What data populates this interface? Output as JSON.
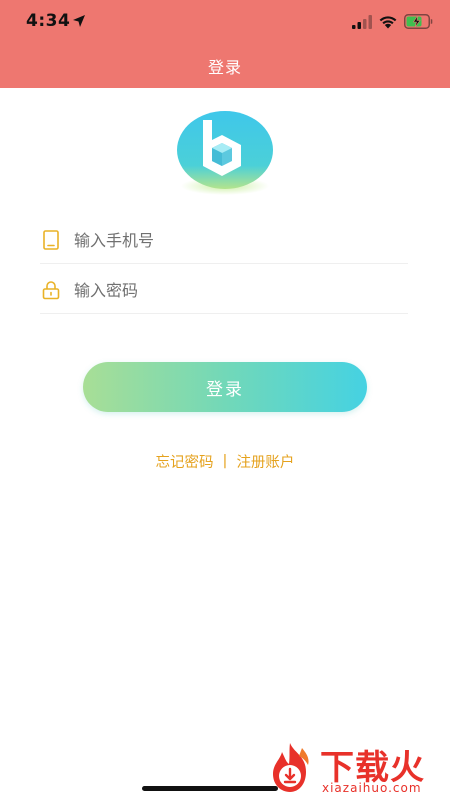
{
  "status_bar": {
    "time": "4:34"
  },
  "nav": {
    "title": "登录"
  },
  "form": {
    "phone_placeholder": "输入手机号",
    "password_placeholder": "输入密码",
    "login_label": "登录"
  },
  "links": {
    "forgot": "忘记密码",
    "separator": "|",
    "register": "注册账户"
  },
  "watermark": {
    "title": "下载火",
    "url": "xiazaihuo.com"
  },
  "colors": {
    "header": "#ee7770",
    "link": "#e5a21e",
    "button_start": "#a8de96",
    "button_end": "#45d2e2",
    "field_icon": "#e9b227",
    "watermark": "#e8312a"
  },
  "icons": {
    "location": "location-arrow-icon",
    "signal": "cellular-signal-icon",
    "wifi": "wifi-icon",
    "battery": "battery-charging-icon",
    "phone": "phone-icon",
    "lock": "lock-icon",
    "logo": "app-logo-b-icon",
    "flame": "flame-logo-icon"
  }
}
